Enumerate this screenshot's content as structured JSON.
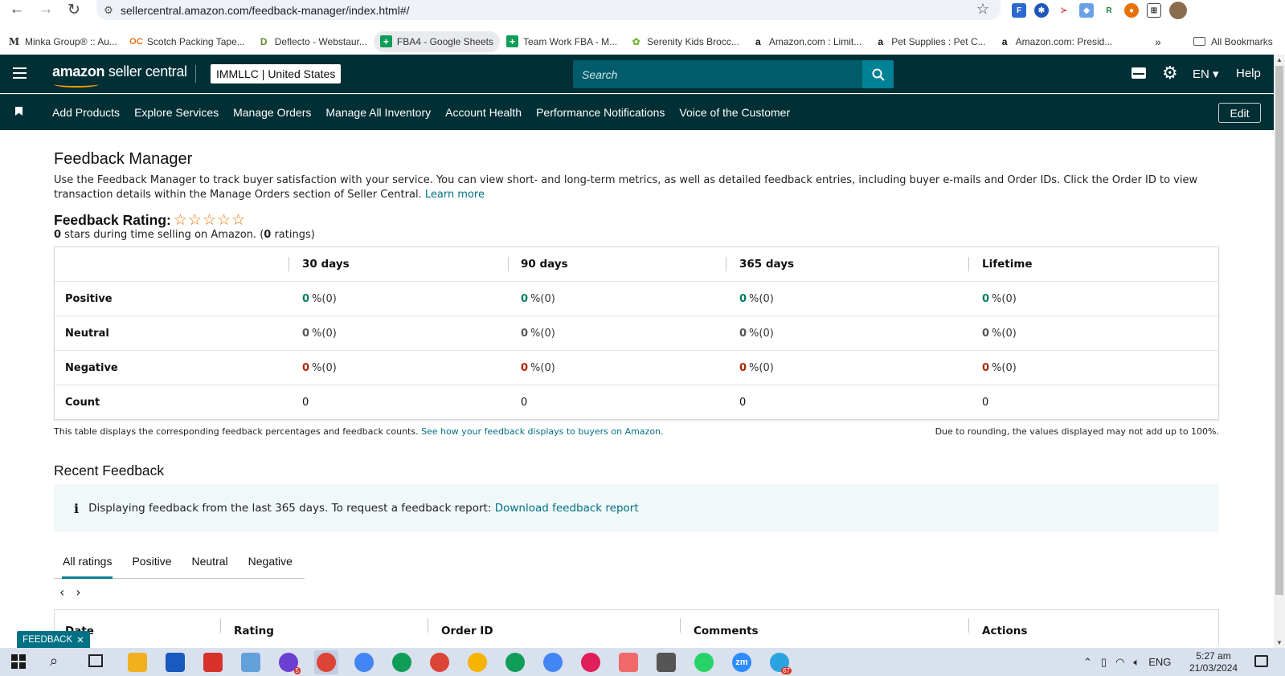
{
  "browser": {
    "url": "sellercentral.amazon.com/feedback-manager/index.html#/",
    "bookmarks": [
      {
        "icon": "M",
        "label": "Minka Group® :: Au...",
        "color": "#333333"
      },
      {
        "icon": "OC",
        "label": "Scotch Packing Tape...",
        "color": "#e8710a"
      },
      {
        "icon": "D",
        "label": "Deflecto - Webstaur...",
        "color": "#5c8a2f"
      },
      {
        "icon": "+",
        "label": "FBA4 - Google Sheets",
        "color": "#0f9d58"
      },
      {
        "icon": "+",
        "label": "Team Work FBA - M...",
        "color": "#0f9d58"
      },
      {
        "icon": "✿",
        "label": "Serenity Kids Brocc...",
        "color": "#7cb342"
      },
      {
        "icon": "a",
        "label": "Amazon.com : Limit...",
        "color": "#111111"
      },
      {
        "icon": "a",
        "label": "Pet Supplies : Pet C...",
        "color": "#111111"
      },
      {
        "icon": "a",
        "label": "Amazon.com: Presid...",
        "color": "#111111"
      }
    ],
    "bookmarks_more": "»",
    "all_bookmarks": "All Bookmarks"
  },
  "header": {
    "logo_brand": "amazon",
    "logo_suffix": " seller central",
    "account": "IMMLLC | United States",
    "search_placeholder": "Search",
    "language": "EN ▾",
    "help": "Help"
  },
  "nav": {
    "items": [
      "Add Products",
      "Explore Services",
      "Manage Orders",
      "Manage All Inventory",
      "Account Health",
      "Performance Notifications",
      "Voice of the Customer"
    ],
    "edit": "Edit"
  },
  "page": {
    "title": "Feedback Manager",
    "intro": "Use the Feedback Manager to track buyer satisfaction with your service. You can view short- and long-term metrics, as well as detailed feedback entries, including buyer e-mails and Order IDs. Click the Order ID to view transaction details within the Manage Orders section of Seller Central.",
    "learn_more": "Learn more",
    "rating_title": "Feedback Rating:",
    "stars": "☆☆☆☆☆",
    "rating_stars": 0,
    "rating_count": "0",
    "rating_sub_1": " stars during time selling on Amazon. (",
    "rating_sub_2": " ratings)"
  },
  "feedback_table": {
    "columns": [
      "30 days",
      "90 days",
      "365 days",
      "Lifetime"
    ],
    "rows": {
      "positive": {
        "label": "Positive",
        "values": [
          "0",
          "0",
          "0",
          "0"
        ],
        "pct": [
          "%(0)",
          "%(0)",
          "%(0)",
          "%(0)"
        ]
      },
      "neutral": {
        "label": "Neutral",
        "values": [
          "0",
          "0",
          "0",
          "0"
        ],
        "pct": [
          "%(0)",
          "%(0)",
          "%(0)",
          "%(0)"
        ]
      },
      "negative": {
        "label": "Negative",
        "values": [
          "0",
          "0",
          "0",
          "0"
        ],
        "pct": [
          "%(0)",
          "%(0)",
          "%(0)",
          "%(0)"
        ]
      },
      "count": {
        "label": "Count",
        "values": [
          "0",
          "0",
          "0",
          "0"
        ]
      }
    },
    "note": "This table displays the corresponding feedback percentages and feedback counts.",
    "note_link": "See how your feedback displays to buyers on Amazon.",
    "rounding_note": "Due to rounding, the values displayed may not add up to 100%."
  },
  "recent": {
    "title": "Recent Feedback",
    "info_text": "Displaying feedback from the last 365 days. To request a feedback report:",
    "info_link": "Download feedback report",
    "tabs": [
      "All ratings",
      "Positive",
      "Neutral",
      "Negative"
    ],
    "list_columns": [
      "Date",
      "Rating",
      "Order ID",
      "Comments",
      "Actions"
    ]
  },
  "feedback_button": "FEEDBACK",
  "taskbar": {
    "apps": [
      {
        "name": "file-explorer",
        "color": "#f2b01e",
        "shape": "sq"
      },
      {
        "name": "word",
        "color": "#185abd",
        "shape": "sq"
      },
      {
        "name": "wps",
        "color": "#d7322c",
        "shape": "sq"
      },
      {
        "name": "notepad",
        "color": "#64a0dc",
        "shape": "sq"
      },
      {
        "name": "app-badge",
        "color": "#6b3fd1",
        "shape": "round",
        "badge": "5"
      },
      {
        "name": "chrome-active",
        "color": "#db4437",
        "shape": "round"
      },
      {
        "name": "chrome",
        "color": "#4285f4",
        "shape": "round"
      },
      {
        "name": "chrome-r",
        "color": "#0f9d58",
        "shape": "round"
      },
      {
        "name": "chrome-r2",
        "color": "#db4437",
        "shape": "round"
      },
      {
        "name": "chrome-r3",
        "color": "#f4b400",
        "shape": "round"
      },
      {
        "name": "chrome-r4",
        "color": "#0f9d58",
        "shape": "round"
      },
      {
        "name": "chrome-r5",
        "color": "#4285f4",
        "shape": "round"
      },
      {
        "name": "slack",
        "color": "#e01e5a",
        "shape": "round"
      },
      {
        "name": "asana",
        "color": "#f06a6a",
        "shape": "sq"
      },
      {
        "name": "calculator",
        "color": "#555555",
        "shape": "sq"
      },
      {
        "name": "whatsapp",
        "color": "#25d366",
        "shape": "round"
      },
      {
        "name": "zoom",
        "color": "#2d8cff",
        "shape": "round",
        "label": "zm"
      },
      {
        "name": "telegram",
        "color": "#2aa3de",
        "shape": "round",
        "badge": "67"
      }
    ],
    "lang": "ENG",
    "time": "5:27 am",
    "date": "21/03/2024"
  }
}
